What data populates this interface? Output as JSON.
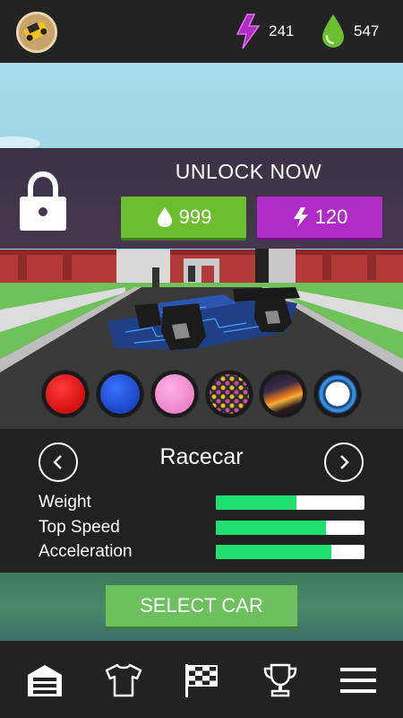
{
  "header": {
    "energy_count": "241",
    "drops_count": "547",
    "colors": {
      "energy": "#b02bc7",
      "drops": "#6bbf2f"
    }
  },
  "unlock": {
    "title": "UNLOCK NOW",
    "price_drops": "999",
    "price_energy": "120"
  },
  "paints": [
    {
      "name": "red",
      "color": "#e01515"
    },
    {
      "name": "blue",
      "color": "#1e4fcf"
    },
    {
      "name": "pink",
      "color": "#f28fd0"
    },
    {
      "name": "pattern-dots",
      "color": "#3a3a3a"
    },
    {
      "name": "fire",
      "color": "#6b3a1a"
    },
    {
      "name": "circuit",
      "color": "#1c6fb0"
    }
  ],
  "car": {
    "name": "Racecar",
    "stats": [
      {
        "label": "Weight",
        "value": 0.54
      },
      {
        "label": "Top Speed",
        "value": 0.74
      },
      {
        "label": "Acceleration",
        "value": 0.78
      }
    ]
  },
  "select_label": "SELECT CAR",
  "nav": [
    "garage-icon",
    "shirt-icon",
    "checkered-flag-icon",
    "trophy-icon",
    "menu-icon"
  ]
}
